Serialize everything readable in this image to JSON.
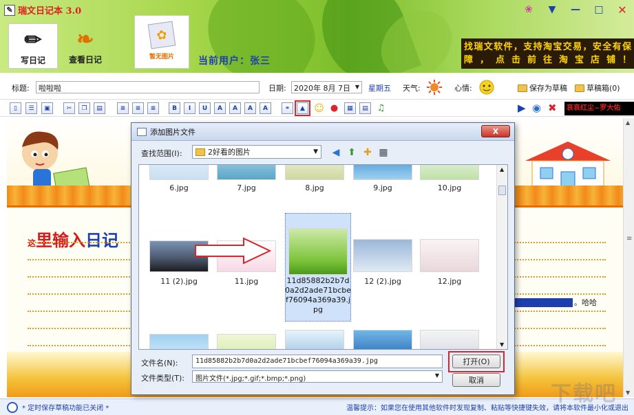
{
  "app": {
    "title": "瑞文日记本 3.0"
  },
  "nav": {
    "write": "写日记",
    "view": "查看日记",
    "photo": "暂无图片"
  },
  "user": {
    "label": "当前用户：张三"
  },
  "promo": {
    "text": "找瑞文软件，支持淘宝交易，安全有保障，点击前往淘宝店铺！"
  },
  "form": {
    "title_label": "标题:",
    "title_value": "啦啦啦",
    "date_label": "日期:",
    "date_value": "2020年 8月 7日",
    "weekday": "星期五",
    "weather_label": "天气:",
    "mood_label": "心情:",
    "save_draft": "保存为草稿",
    "drafts": "草稿箱(0)"
  },
  "toolbar": {
    "marquee": "哀哀红尘~罗大佑"
  },
  "editor": {
    "prefix": "这",
    "line_red": "里输入",
    "line_blue": "日记",
    "tail": "。哈哈"
  },
  "status": {
    "left": "* 定时保存草稿功能已关闭 *",
    "right_prefix": "温馨提示：如果您在使用其他软件时发现复制、粘贴等快捷键失效，请将本软件最小化或退出"
  },
  "dialog": {
    "title": "添加图片文件",
    "close": "X",
    "lookin_label": "查找范围(I):",
    "lookin_value": "2好看的图片",
    "files": [
      {
        "name": "6.jpg"
      },
      {
        "name": "7.jpg"
      },
      {
        "name": "8.jpg"
      },
      {
        "name": "9.jpg"
      },
      {
        "name": "10.jpg"
      },
      {
        "name": "11 (2).jpg"
      },
      {
        "name": "11.jpg"
      },
      {
        "name": "11d85882b2b7d0a2d2ade71bcbef76094a369a39.jpg"
      },
      {
        "name": "12 (2).jpg"
      },
      {
        "name": "12.jpg"
      }
    ],
    "filename_label": "文件名(N):",
    "filename_value": "11d85882b2b7d0a2d2ade71bcbef76094a369a39.jpg",
    "filetype_label": "文件类型(T):",
    "filetype_value": "图片文件(*.jpg;*.gif;*.bmp;*.png)",
    "open": "打开(O)",
    "cancel": "取消"
  },
  "watermark": "下载吧",
  "colors": {
    "accent_blue": "#1d3fb0",
    "accent_red": "#d01c1c",
    "promo_bg": "#2a1a08",
    "promo_fg": "#ffd400"
  }
}
